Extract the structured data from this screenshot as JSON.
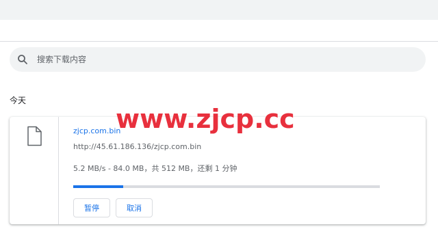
{
  "search": {
    "placeholder": "搜索下载内容",
    "icon": "search-icon"
  },
  "section": {
    "label": "今天"
  },
  "download": {
    "file_icon": "file-icon",
    "file_name": "zjcp.com.bin",
    "url": "http://45.61.186.136/zjcp.com.bin",
    "status": "5.2 MB/s - 84.0 MB，共 512 MB，还剩 1 分钟",
    "progress_fraction": 0.164,
    "pause_label": "暂停",
    "cancel_label": "取消"
  },
  "watermark": {
    "text": "www.zjcp.cc"
  },
  "colors": {
    "accent": "#1a73e8",
    "watermark": "#e8303d"
  }
}
